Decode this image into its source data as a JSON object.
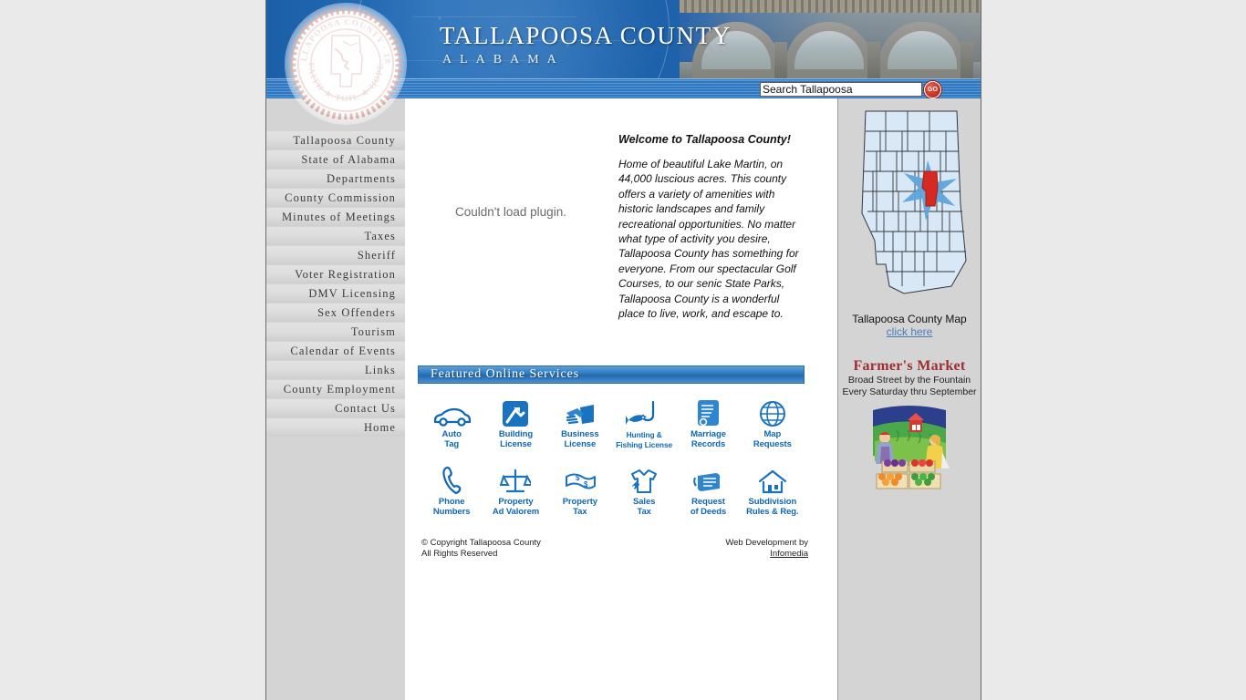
{
  "header": {
    "title": "TALLAPOOSA COUNTY",
    "subtitle": "ALABAMA",
    "seal": {
      "top_text": "TALLAPOOSA COUNTY",
      "year": "1832",
      "bottom_text": "FAITH ★ TOIL ★ HOPE"
    }
  },
  "search": {
    "value": "Search Tallapoosa",
    "placeholder": "Search Tallapoosa",
    "go_label": "GO"
  },
  "sidebar": {
    "items": [
      {
        "label": "Tallapoosa County"
      },
      {
        "label": "State of Alabama"
      },
      {
        "label": "Departments"
      },
      {
        "label": "County Commission"
      },
      {
        "label": "Minutes of Meetings"
      },
      {
        "label": "Taxes"
      },
      {
        "label": "Sheriff"
      },
      {
        "label": "Voter Registration"
      },
      {
        "label": "DMV Licensing"
      },
      {
        "label": "Sex Offenders"
      },
      {
        "label": "Tourism"
      },
      {
        "label": "Calendar of Events"
      },
      {
        "label": "Links"
      },
      {
        "label": "County Employment"
      },
      {
        "label": "Contact Us"
      },
      {
        "label": "Home"
      }
    ]
  },
  "main": {
    "plugin_message": "Couldn't load plugin.",
    "welcome_heading": "Welcome to Tallapoosa County!",
    "welcome_body": "Home of beautiful Lake Martin, on 44,000 luscious acres. This county offers a variety of amenities with historic landscapes and family recreational opportunities. No matter what type of activity you desire, Tallapoosa County has something for everyone.  From our spectacular Golf Courses, to our senic State Parks, Tallapoosa County is a wonderful place to live, work, and escape to.",
    "featured_heading": "Featured Online Services",
    "services": [
      {
        "line1": "Auto",
        "line2": "Tag",
        "icon": "car-icon"
      },
      {
        "line1": "Building",
        "line2": "License",
        "icon": "hammer-icon"
      },
      {
        "line1": "Business",
        "line2": "License",
        "icon": "handshake-icon"
      },
      {
        "line1": "Hunting &",
        "line2": "Fishing License",
        "icon": "fish-hook-icon"
      },
      {
        "line1": "Marriage",
        "line2": "Records",
        "icon": "scroll-icon"
      },
      {
        "line1": "Map",
        "line2": "Requests",
        "icon": "globe-icon"
      },
      {
        "line1": "Phone",
        "line2": "Numbers",
        "icon": "phone-icon"
      },
      {
        "line1": "Property",
        "line2": "Ad Valorem",
        "icon": "scales-icon"
      },
      {
        "line1": "Property",
        "line2": "Tax",
        "icon": "money-icon"
      },
      {
        "line1": "Sales",
        "line2": "Tax",
        "icon": "shirt-tag-icon"
      },
      {
        "line1": "Request",
        "line2": "of Deeds",
        "icon": "deed-document-icon"
      },
      {
        "line1": "Subdivision",
        "line2": "Rules & Reg.",
        "icon": "house-icon"
      }
    ]
  },
  "footer": {
    "copyright_line1": "© Copyright Tallapoosa County",
    "copyright_line2": "All Rights Reserved",
    "dev_line1": "Web Development by",
    "dev_link": "Infomedia"
  },
  "right": {
    "map_caption": "Tallapoosa County Map",
    "map_link": "click here",
    "farmers_title": "Farmer's Market",
    "farmers_line1": "Broad Street by the Fountain",
    "farmers_line2": "Every Saturday thru September"
  },
  "colors": {
    "header_blue": "#2b72bb",
    "accent_red": "#b01d10",
    "icon_blue": "#0f67b8",
    "link_blue": "#4a7ebb",
    "farmers_red": "#9e2d2d",
    "page_grey": "#d4d4d4"
  }
}
